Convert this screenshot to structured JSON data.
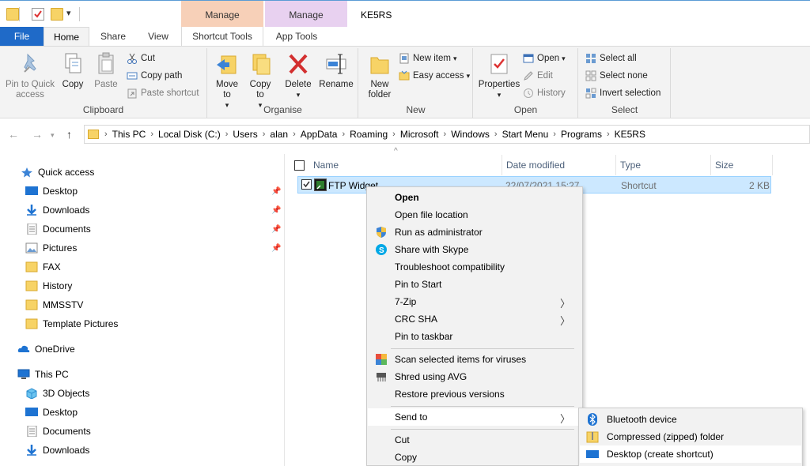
{
  "window": {
    "title": "KE5RS",
    "context_tabs": [
      "Manage",
      "Manage"
    ]
  },
  "ribbon_tabs": {
    "file": "File",
    "home": "Home",
    "share": "Share",
    "view": "View",
    "shortcut_tools": "Shortcut Tools",
    "app_tools": "App Tools"
  },
  "ribbon": {
    "clipboard": {
      "label": "Clipboard",
      "pin": "Pin to Quick access",
      "copy": "Copy",
      "paste": "Paste",
      "cut": "Cut",
      "copy_path": "Copy path",
      "paste_shortcut": "Paste shortcut"
    },
    "organise": {
      "label": "Organise",
      "move_to": "Move to",
      "copy_to": "Copy to",
      "delete": "Delete",
      "rename": "Rename"
    },
    "new": {
      "label": "New",
      "new_folder": "New folder",
      "new_item": "New item",
      "easy_access": "Easy access"
    },
    "open": {
      "label": "Open",
      "properties": "Properties",
      "open": "Open",
      "edit": "Edit",
      "history": "History"
    },
    "select": {
      "label": "Select",
      "select_all": "Select all",
      "select_none": "Select none",
      "invert_selection": "Invert selection"
    }
  },
  "address": {
    "crumbs": [
      "This PC",
      "Local Disk (C:)",
      "Users",
      "alan",
      "AppData",
      "Roaming",
      "Microsoft",
      "Windows",
      "Start Menu",
      "Programs",
      "KE5RS"
    ]
  },
  "nav": {
    "quick_access": "Quick access",
    "quick_items": [
      "Desktop",
      "Downloads",
      "Documents",
      "Pictures",
      "FAX",
      "History",
      "MMSSTV",
      "Template Pictures"
    ],
    "onedrive": "OneDrive",
    "this_pc": "This PC",
    "pc_items": [
      "3D Objects",
      "Desktop",
      "Documents",
      "Downloads"
    ]
  },
  "columns": {
    "name": "Name",
    "date": "Date modified",
    "type": "Type",
    "size": "Size"
  },
  "files": [
    {
      "name": "FTP Widget",
      "date": "22/07/2021 15:27",
      "type": "Shortcut",
      "size": "2 KB"
    }
  ],
  "context_menu": {
    "items": [
      "Open",
      "Open file location",
      "Run as administrator",
      "Share with Skype",
      "Troubleshoot compatibility",
      "Pin to Start",
      "7-Zip",
      "CRC SHA",
      "Pin to taskbar",
      "Scan selected items for viruses",
      "Shred using AVG",
      "Restore previous versions",
      "Send to",
      "Cut",
      "Copy"
    ]
  },
  "send_to_menu": {
    "items": [
      "Bluetooth device",
      "Compressed (zipped) folder",
      "Desktop (create shortcut)"
    ]
  },
  "colors": {
    "accent": "#1f6ac8",
    "selection": "#cce8ff",
    "manage_shortcut": "#f7d0b8",
    "manage_app": "#e8d1f0"
  }
}
